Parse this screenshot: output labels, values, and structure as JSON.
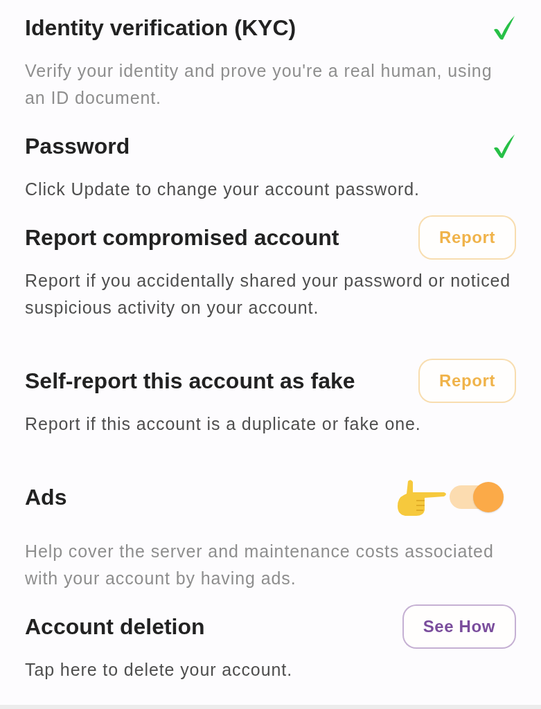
{
  "sections": [
    {
      "kind": "check",
      "title": "Identity verification (KYC)",
      "description": "Verify your identity and prove you're a real human, using an ID document.",
      "muted": true,
      "verified": true
    },
    {
      "kind": "check",
      "title": "Password",
      "description": "Click Update to change your account password.",
      "muted": false,
      "verified": true
    },
    {
      "kind": "button",
      "title": "Report compromised account",
      "description": "Report if you accidentally shared your password or noticed suspicious activity on your account.",
      "muted": false,
      "button": {
        "label": "Report",
        "color": "#f0b34a"
      }
    },
    {
      "kind": "button",
      "title": "Self-report this account as fake",
      "description": "Report if this account is a duplicate or fake one.",
      "muted": false,
      "button": {
        "label": "Report",
        "color": "#f0b34a"
      }
    },
    {
      "kind": "toggle",
      "title": "Ads",
      "description": "Help cover the server and maintenance costs associated with your account by having ads.",
      "muted": true,
      "on": true,
      "pointer_hint": true
    },
    {
      "kind": "button",
      "title": "Account deletion",
      "description": "Tap here to delete your account.",
      "muted": false,
      "button": {
        "label": "See How",
        "color": "#7a4d9c"
      }
    }
  ]
}
